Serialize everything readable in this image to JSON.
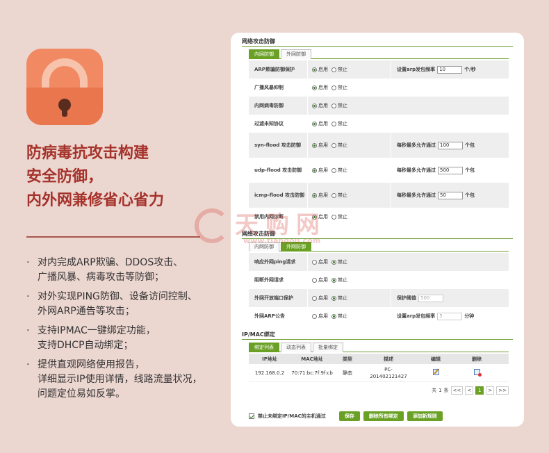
{
  "promo": {
    "headline": [
      "防病毒抗攻击构建",
      "安全防御，",
      "内外网兼修省心省力"
    ],
    "features": [
      [
        "对内完成ARP欺骗、DDOS攻击、",
        "广播风暴、病毒攻击等防御；"
      ],
      [
        "对外实现PING防御、设备访问控制、",
        "外网ARP通告等攻击；"
      ],
      [
        "支持IPMAC一键绑定功能，",
        "支持DHCP自动绑定；"
      ],
      [
        "提供直观网络使用报告，",
        "详细显示IP使用详情，线路流量状况，",
        "问题定位易如反掌。"
      ]
    ],
    "bullet": "·",
    "watermark": {
      "text": "天购网",
      "url": "www.tiangou.com"
    }
  },
  "ui": {
    "colors": {
      "accent": "#6aa125",
      "headline": "#a4322a"
    },
    "sections": {
      "inner": {
        "title": "网络攻击防御",
        "tabs": [
          {
            "label": "内网防御",
            "active": true
          },
          {
            "label": "外网防御",
            "active": false
          }
        ],
        "rows": [
          {
            "label": "ARP欺骗防御保护",
            "enable": "启用",
            "disable": "禁止",
            "on": true,
            "extra_label": "设置arp发包频率",
            "extra_value": "10",
            "extra_unit": "个/秒"
          },
          {
            "label": "广播风暴抑制",
            "enable": "启用",
            "disable": "禁止",
            "on": true
          },
          {
            "label": "内网病毒防御",
            "enable": "启用",
            "disable": "禁止",
            "on": true
          },
          {
            "label": "过滤未知协议",
            "enable": "启用",
            "disable": "禁止",
            "on": true
          },
          {
            "label": "syn-flood 攻击防御",
            "enable": "启用",
            "disable": "禁止",
            "on": true,
            "extra_label": "每秒最多允许通过",
            "extra_value": "100",
            "extra_unit": "个包"
          },
          {
            "label": "udp-flood 攻击防御",
            "enable": "启用",
            "disable": "禁止",
            "on": true,
            "extra_label": "每秒最多允许通过",
            "extra_value": "500",
            "extra_unit": "个包"
          },
          {
            "label": "icmp-flood 攻击防御",
            "enable": "启用",
            "disable": "禁止",
            "on": true,
            "extra_label": "每秒最多允许通过",
            "extra_value": "50",
            "extra_unit": "个包"
          },
          {
            "label": "禁用内网诊断",
            "enable": "启用",
            "disable": "禁止",
            "on": true
          }
        ]
      },
      "outer": {
        "title": "网络攻击防御",
        "tabs": [
          {
            "label": "内网防御",
            "active": false
          },
          {
            "label": "外网防御",
            "active": true
          }
        ],
        "rows": [
          {
            "label": "响应外网ping请求",
            "enable": "启用",
            "disable": "禁止",
            "on": false
          },
          {
            "label": "阻断外网请求",
            "enable": "启用",
            "disable": "禁止",
            "on": false
          },
          {
            "label": "外网开放端口保护",
            "enable": "启用",
            "disable": "禁止",
            "on": false,
            "extra_label": "保护阈值",
            "extra_value": "500",
            "extra_unit": "",
            "disabled": true
          },
          {
            "label": "外网ARP公告",
            "enable": "启用",
            "disable": "禁止",
            "on": false,
            "extra_label": "设置arp发包频率",
            "extra_value": "5",
            "extra_unit": "分钟",
            "disabled": true
          }
        ]
      },
      "ipmac": {
        "title": "IP/MAC绑定",
        "tabs": [
          {
            "label": "绑定列表",
            "active": true
          },
          {
            "label": "动态列表",
            "active": false
          },
          {
            "label": "批量绑定",
            "active": false
          }
        ],
        "columns": [
          "IP地址",
          "MAC地址",
          "类型",
          "描述",
          "编辑",
          "删除"
        ],
        "rows": [
          {
            "ip": "192.168.0.2",
            "mac": "70:71:bc:7f:9f:cb",
            "type": "静态",
            "desc": "PC-\n201402121427"
          }
        ],
        "pager": {
          "prefix": "共",
          "total": "1",
          "suffix": "条",
          "first": "<<",
          "prev": "<",
          "current": "1",
          "next": ">",
          "last": ">>"
        }
      }
    },
    "footer": {
      "checkbox_label": "禁止未绑定IP/MAC的主机通过",
      "checked": true,
      "buttons": {
        "save": "保存",
        "delete_all": "删除所有绑定",
        "add_rule": "添加新规则"
      }
    }
  }
}
